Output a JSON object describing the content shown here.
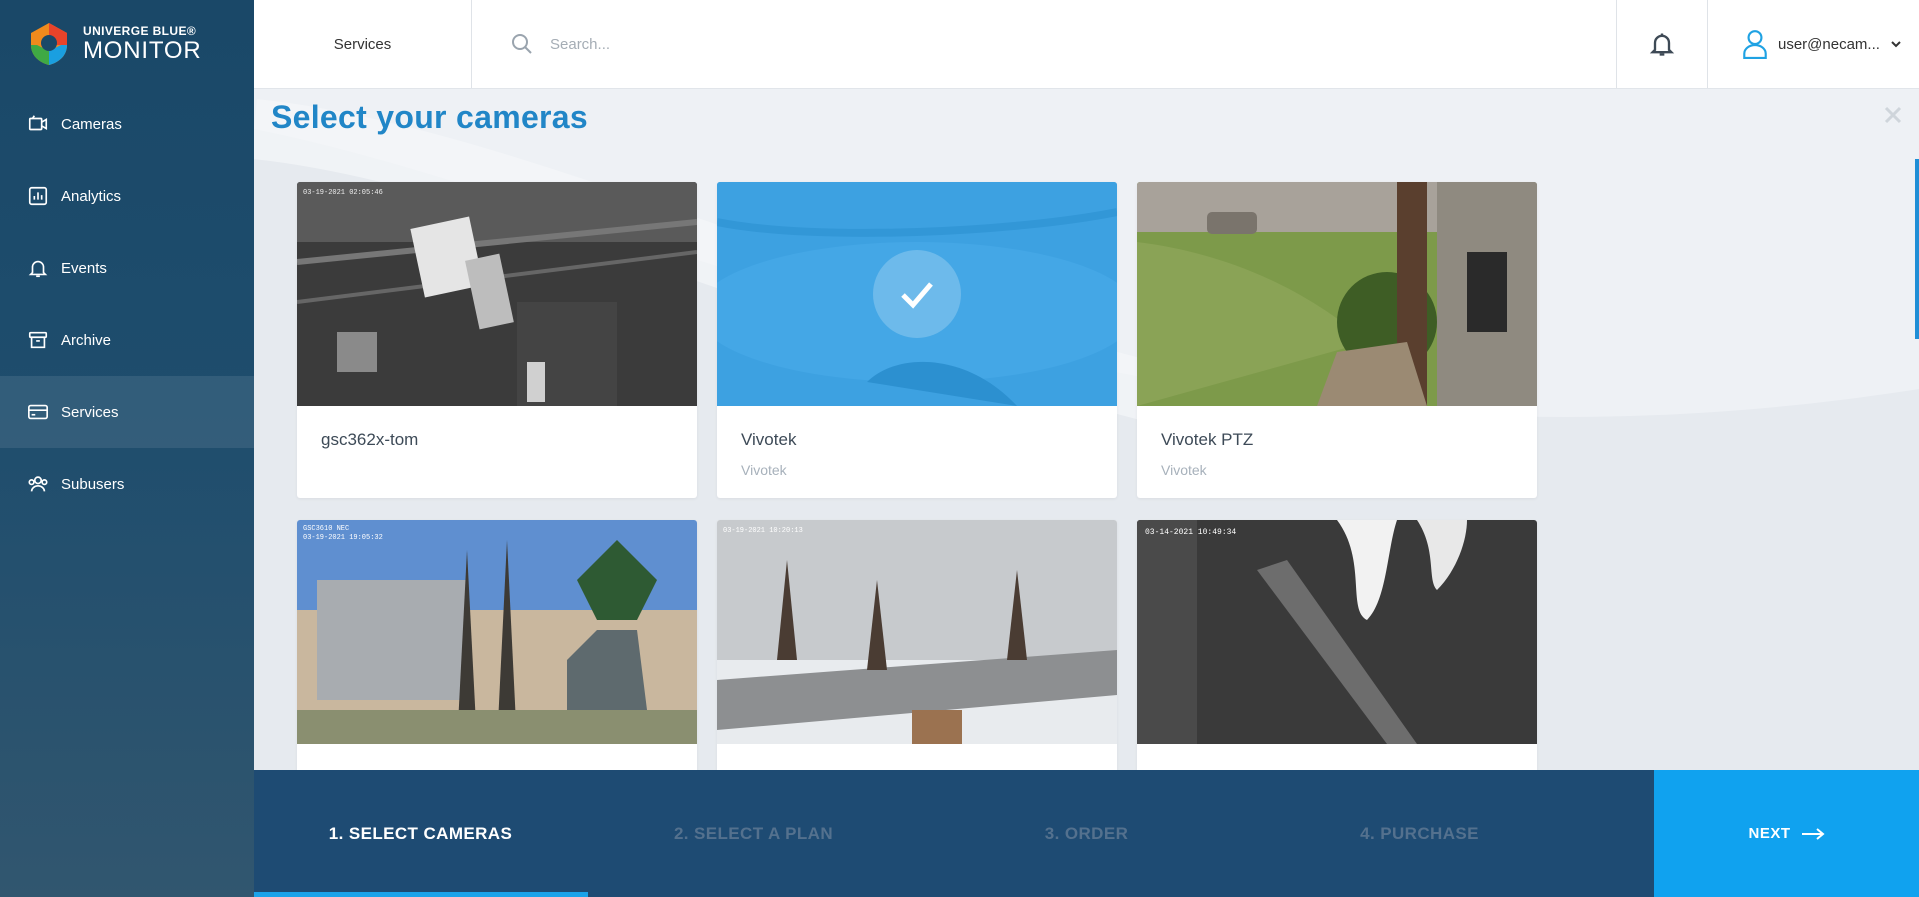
{
  "brand": {
    "name_top": "UNIVERGE BLUE®",
    "name_bottom": "MONITOR",
    "logo_icon": "brand-logo-icon"
  },
  "sidebar": {
    "items": [
      {
        "label": "Cameras",
        "icon": "camera-icon",
        "active": false
      },
      {
        "label": "Analytics",
        "icon": "chart-icon",
        "active": false
      },
      {
        "label": "Events",
        "icon": "bell-icon",
        "active": false
      },
      {
        "label": "Archive",
        "icon": "archive-icon",
        "active": false
      },
      {
        "label": "Services",
        "icon": "card-icon",
        "active": true
      },
      {
        "label": "Subusers",
        "icon": "users-icon",
        "active": false
      }
    ]
  },
  "topbar": {
    "breadcrumb": "Services",
    "search_placeholder": "Search...",
    "user_label": "user@necam..."
  },
  "main": {
    "title": "Select your cameras",
    "cameras": [
      {
        "name": "gsc362x-tom",
        "vendor": "",
        "selected": false,
        "thumb_overlay": "03-19-2021 02:05:46"
      },
      {
        "name": "Vivotek",
        "vendor": "Vivotek",
        "selected": true,
        "thumb_overlay": ""
      },
      {
        "name": "Vivotek PTZ",
        "vendor": "Vivotek",
        "selected": false,
        "thumb_overlay": ""
      },
      {
        "name": "",
        "vendor": "",
        "selected": false,
        "thumb_overlay": "GSC3610 NEC\n03-19-2021 19:05:32"
      },
      {
        "name": "",
        "vendor": "",
        "selected": false,
        "thumb_overlay": "03-19-2021 10:20:13"
      },
      {
        "name": "",
        "vendor": "",
        "selected": false,
        "thumb_overlay": "03-14-2021 10:49:34"
      }
    ]
  },
  "wizard": {
    "steps": [
      "1. SELECT CAMERAS",
      "2. SELECT A PLAN",
      "3. ORDER",
      "4. PURCHASE"
    ],
    "active_step": 0,
    "next_label": "NEXT"
  },
  "colors": {
    "sidebar_bg": "#1a4868",
    "accent": "#1fa2e3",
    "title": "#2186c7",
    "wizard_bg": "#1e4b73",
    "next_bg": "#10a2ef"
  }
}
